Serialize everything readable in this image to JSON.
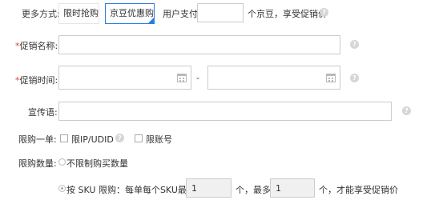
{
  "more_methods": {
    "label": "更多方式:",
    "options": [
      {
        "label": "限时抢购",
        "selected": false
      },
      {
        "label": "京豆优惠购",
        "selected": true
      }
    ],
    "user_pay_prefix": "用户支付",
    "user_pay_value": "",
    "user_pay_suffix": "个京豆，享受促销价"
  },
  "promo_name": {
    "required_mark": "*",
    "label": "促销名称:",
    "value": ""
  },
  "promo_time": {
    "required_mark": "*",
    "label": "促销时间:",
    "start_value": "",
    "separator": "-",
    "end_value": ""
  },
  "slogan": {
    "label": "宣传语:",
    "value": ""
  },
  "limit_one": {
    "label": "限购一单:",
    "ip_udid_label": "限IP/UDID",
    "ip_udid_checked": false,
    "account_label": "限账号",
    "account_checked": false
  },
  "limit_qty": {
    "label": "限购数量:",
    "unlimited_label": "不限制购买数量",
    "unlimited_selected": false,
    "sku_label": "按 SKU 限购：每单每个SKU最少",
    "sku_selected": true,
    "min_value": "1",
    "mid_text": "个，最多",
    "max_value": "1",
    "end_text": "个，才能享受促销价"
  },
  "help_glyph": "?"
}
